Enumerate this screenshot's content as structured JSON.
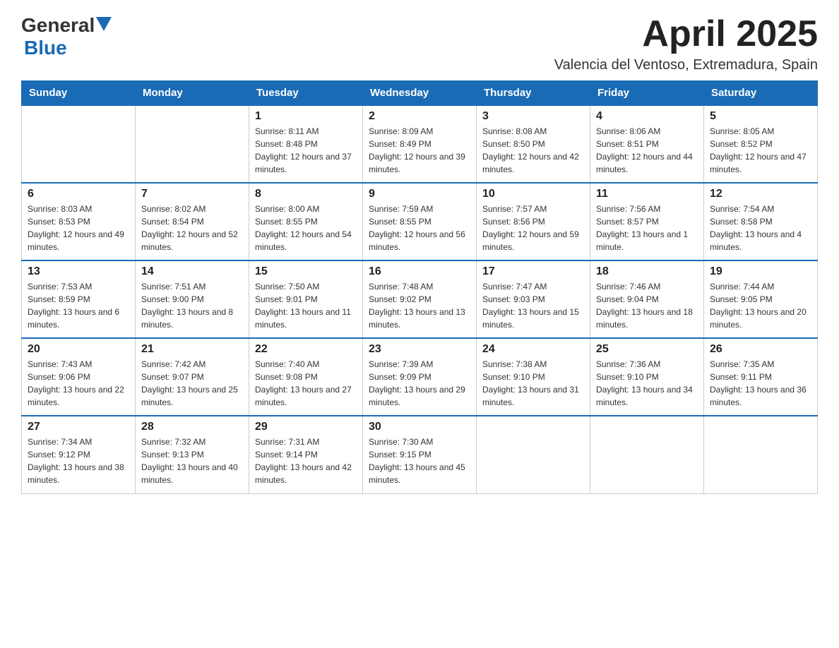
{
  "header": {
    "logo_general": "General",
    "logo_blue": "Blue",
    "month_title": "April 2025",
    "subtitle": "Valencia del Ventoso, Extremadura, Spain"
  },
  "weekdays": [
    "Sunday",
    "Monday",
    "Tuesday",
    "Wednesday",
    "Thursday",
    "Friday",
    "Saturday"
  ],
  "weeks": [
    [
      {
        "day": "",
        "sunrise": "",
        "sunset": "",
        "daylight": ""
      },
      {
        "day": "",
        "sunrise": "",
        "sunset": "",
        "daylight": ""
      },
      {
        "day": "1",
        "sunrise": "Sunrise: 8:11 AM",
        "sunset": "Sunset: 8:48 PM",
        "daylight": "Daylight: 12 hours and 37 minutes."
      },
      {
        "day": "2",
        "sunrise": "Sunrise: 8:09 AM",
        "sunset": "Sunset: 8:49 PM",
        "daylight": "Daylight: 12 hours and 39 minutes."
      },
      {
        "day": "3",
        "sunrise": "Sunrise: 8:08 AM",
        "sunset": "Sunset: 8:50 PM",
        "daylight": "Daylight: 12 hours and 42 minutes."
      },
      {
        "day": "4",
        "sunrise": "Sunrise: 8:06 AM",
        "sunset": "Sunset: 8:51 PM",
        "daylight": "Daylight: 12 hours and 44 minutes."
      },
      {
        "day": "5",
        "sunrise": "Sunrise: 8:05 AM",
        "sunset": "Sunset: 8:52 PM",
        "daylight": "Daylight: 12 hours and 47 minutes."
      }
    ],
    [
      {
        "day": "6",
        "sunrise": "Sunrise: 8:03 AM",
        "sunset": "Sunset: 8:53 PM",
        "daylight": "Daylight: 12 hours and 49 minutes."
      },
      {
        "day": "7",
        "sunrise": "Sunrise: 8:02 AM",
        "sunset": "Sunset: 8:54 PM",
        "daylight": "Daylight: 12 hours and 52 minutes."
      },
      {
        "day": "8",
        "sunrise": "Sunrise: 8:00 AM",
        "sunset": "Sunset: 8:55 PM",
        "daylight": "Daylight: 12 hours and 54 minutes."
      },
      {
        "day": "9",
        "sunrise": "Sunrise: 7:59 AM",
        "sunset": "Sunset: 8:55 PM",
        "daylight": "Daylight: 12 hours and 56 minutes."
      },
      {
        "day": "10",
        "sunrise": "Sunrise: 7:57 AM",
        "sunset": "Sunset: 8:56 PM",
        "daylight": "Daylight: 12 hours and 59 minutes."
      },
      {
        "day": "11",
        "sunrise": "Sunrise: 7:56 AM",
        "sunset": "Sunset: 8:57 PM",
        "daylight": "Daylight: 13 hours and 1 minute."
      },
      {
        "day": "12",
        "sunrise": "Sunrise: 7:54 AM",
        "sunset": "Sunset: 8:58 PM",
        "daylight": "Daylight: 13 hours and 4 minutes."
      }
    ],
    [
      {
        "day": "13",
        "sunrise": "Sunrise: 7:53 AM",
        "sunset": "Sunset: 8:59 PM",
        "daylight": "Daylight: 13 hours and 6 minutes."
      },
      {
        "day": "14",
        "sunrise": "Sunrise: 7:51 AM",
        "sunset": "Sunset: 9:00 PM",
        "daylight": "Daylight: 13 hours and 8 minutes."
      },
      {
        "day": "15",
        "sunrise": "Sunrise: 7:50 AM",
        "sunset": "Sunset: 9:01 PM",
        "daylight": "Daylight: 13 hours and 11 minutes."
      },
      {
        "day": "16",
        "sunrise": "Sunrise: 7:48 AM",
        "sunset": "Sunset: 9:02 PM",
        "daylight": "Daylight: 13 hours and 13 minutes."
      },
      {
        "day": "17",
        "sunrise": "Sunrise: 7:47 AM",
        "sunset": "Sunset: 9:03 PM",
        "daylight": "Daylight: 13 hours and 15 minutes."
      },
      {
        "day": "18",
        "sunrise": "Sunrise: 7:46 AM",
        "sunset": "Sunset: 9:04 PM",
        "daylight": "Daylight: 13 hours and 18 minutes."
      },
      {
        "day": "19",
        "sunrise": "Sunrise: 7:44 AM",
        "sunset": "Sunset: 9:05 PM",
        "daylight": "Daylight: 13 hours and 20 minutes."
      }
    ],
    [
      {
        "day": "20",
        "sunrise": "Sunrise: 7:43 AM",
        "sunset": "Sunset: 9:06 PM",
        "daylight": "Daylight: 13 hours and 22 minutes."
      },
      {
        "day": "21",
        "sunrise": "Sunrise: 7:42 AM",
        "sunset": "Sunset: 9:07 PM",
        "daylight": "Daylight: 13 hours and 25 minutes."
      },
      {
        "day": "22",
        "sunrise": "Sunrise: 7:40 AM",
        "sunset": "Sunset: 9:08 PM",
        "daylight": "Daylight: 13 hours and 27 minutes."
      },
      {
        "day": "23",
        "sunrise": "Sunrise: 7:39 AM",
        "sunset": "Sunset: 9:09 PM",
        "daylight": "Daylight: 13 hours and 29 minutes."
      },
      {
        "day": "24",
        "sunrise": "Sunrise: 7:38 AM",
        "sunset": "Sunset: 9:10 PM",
        "daylight": "Daylight: 13 hours and 31 minutes."
      },
      {
        "day": "25",
        "sunrise": "Sunrise: 7:36 AM",
        "sunset": "Sunset: 9:10 PM",
        "daylight": "Daylight: 13 hours and 34 minutes."
      },
      {
        "day": "26",
        "sunrise": "Sunrise: 7:35 AM",
        "sunset": "Sunset: 9:11 PM",
        "daylight": "Daylight: 13 hours and 36 minutes."
      }
    ],
    [
      {
        "day": "27",
        "sunrise": "Sunrise: 7:34 AM",
        "sunset": "Sunset: 9:12 PM",
        "daylight": "Daylight: 13 hours and 38 minutes."
      },
      {
        "day": "28",
        "sunrise": "Sunrise: 7:32 AM",
        "sunset": "Sunset: 9:13 PM",
        "daylight": "Daylight: 13 hours and 40 minutes."
      },
      {
        "day": "29",
        "sunrise": "Sunrise: 7:31 AM",
        "sunset": "Sunset: 9:14 PM",
        "daylight": "Daylight: 13 hours and 42 minutes."
      },
      {
        "day": "30",
        "sunrise": "Sunrise: 7:30 AM",
        "sunset": "Sunset: 9:15 PM",
        "daylight": "Daylight: 13 hours and 45 minutes."
      },
      {
        "day": "",
        "sunrise": "",
        "sunset": "",
        "daylight": ""
      },
      {
        "day": "",
        "sunrise": "",
        "sunset": "",
        "daylight": ""
      },
      {
        "day": "",
        "sunrise": "",
        "sunset": "",
        "daylight": ""
      }
    ]
  ]
}
